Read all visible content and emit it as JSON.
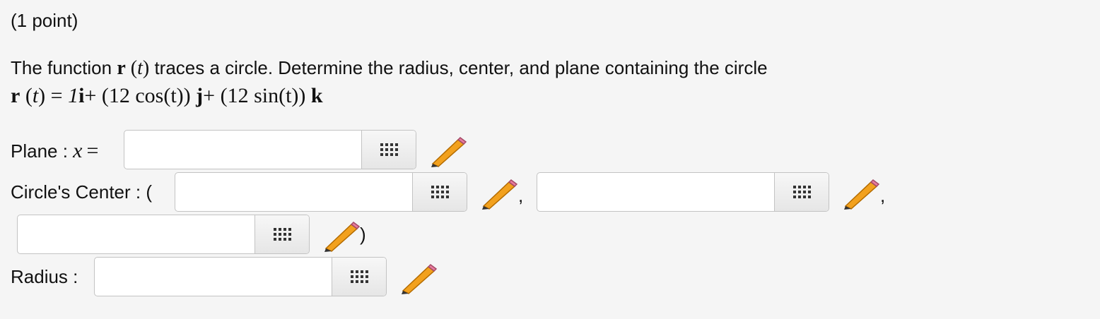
{
  "header": {
    "points": "(1 point)"
  },
  "question": {
    "intro_before": "The function",
    "intro_after": "traces a circle. Determine the radius, center, and plane containing the circle",
    "func_name": "r",
    "func_var": "t",
    "formula": {
      "lhs_name": "r",
      "lhs_var": "t",
      "equals": "=",
      "i_coef": "1",
      "i_unit": "i",
      "plus1": "+",
      "j_term": "(12 cos(t))",
      "j_unit": "j",
      "plus2": "+",
      "k_term": "(12 sin(t))",
      "k_unit": "k"
    }
  },
  "plane": {
    "label": "Plane : ",
    "var": "x",
    "equals": "=",
    "value": ""
  },
  "center": {
    "label": "Circle's Center : (",
    "sep": ",",
    "close": ")",
    "x_value": "",
    "y_value": "",
    "z_value": ""
  },
  "radius": {
    "label": "Radius :",
    "value": ""
  },
  "icons": {
    "palette": "grid-icon",
    "edit": "pencil-icon"
  },
  "colors": {
    "background": "#f5f5f5",
    "input_border": "#c3c3c3",
    "pencil": "#f2a11e"
  }
}
